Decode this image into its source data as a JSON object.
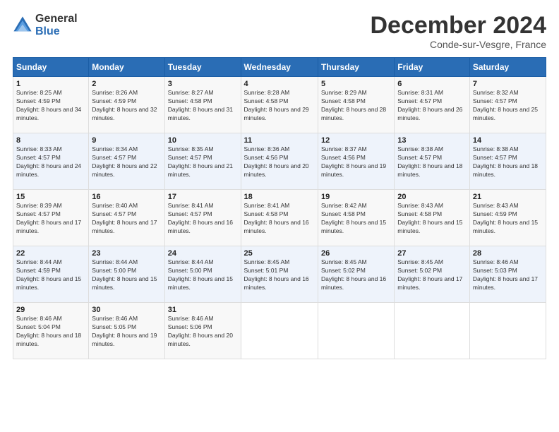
{
  "logo": {
    "general": "General",
    "blue": "Blue"
  },
  "title": "December 2024",
  "location": "Conde-sur-Vesgre, France",
  "headers": [
    "Sunday",
    "Monday",
    "Tuesday",
    "Wednesday",
    "Thursday",
    "Friday",
    "Saturday"
  ],
  "weeks": [
    [
      {
        "num": "1",
        "rise": "8:25 AM",
        "set": "4:59 PM",
        "daylight": "8 hours and 34 minutes."
      },
      {
        "num": "2",
        "rise": "8:26 AM",
        "set": "4:59 PM",
        "daylight": "8 hours and 32 minutes."
      },
      {
        "num": "3",
        "rise": "8:27 AM",
        "set": "4:58 PM",
        "daylight": "8 hours and 31 minutes."
      },
      {
        "num": "4",
        "rise": "8:28 AM",
        "set": "4:58 PM",
        "daylight": "8 hours and 29 minutes."
      },
      {
        "num": "5",
        "rise": "8:29 AM",
        "set": "4:58 PM",
        "daylight": "8 hours and 28 minutes."
      },
      {
        "num": "6",
        "rise": "8:31 AM",
        "set": "4:57 PM",
        "daylight": "8 hours and 26 minutes."
      },
      {
        "num": "7",
        "rise": "8:32 AM",
        "set": "4:57 PM",
        "daylight": "8 hours and 25 minutes."
      }
    ],
    [
      {
        "num": "8",
        "rise": "8:33 AM",
        "set": "4:57 PM",
        "daylight": "8 hours and 24 minutes."
      },
      {
        "num": "9",
        "rise": "8:34 AM",
        "set": "4:57 PM",
        "daylight": "8 hours and 22 minutes."
      },
      {
        "num": "10",
        "rise": "8:35 AM",
        "set": "4:57 PM",
        "daylight": "8 hours and 21 minutes."
      },
      {
        "num": "11",
        "rise": "8:36 AM",
        "set": "4:56 PM",
        "daylight": "8 hours and 20 minutes."
      },
      {
        "num": "12",
        "rise": "8:37 AM",
        "set": "4:56 PM",
        "daylight": "8 hours and 19 minutes."
      },
      {
        "num": "13",
        "rise": "8:38 AM",
        "set": "4:57 PM",
        "daylight": "8 hours and 18 minutes."
      },
      {
        "num": "14",
        "rise": "8:38 AM",
        "set": "4:57 PM",
        "daylight": "8 hours and 18 minutes."
      }
    ],
    [
      {
        "num": "15",
        "rise": "8:39 AM",
        "set": "4:57 PM",
        "daylight": "8 hours and 17 minutes."
      },
      {
        "num": "16",
        "rise": "8:40 AM",
        "set": "4:57 PM",
        "daylight": "8 hours and 17 minutes."
      },
      {
        "num": "17",
        "rise": "8:41 AM",
        "set": "4:57 PM",
        "daylight": "8 hours and 16 minutes."
      },
      {
        "num": "18",
        "rise": "8:41 AM",
        "set": "4:58 PM",
        "daylight": "8 hours and 16 minutes."
      },
      {
        "num": "19",
        "rise": "8:42 AM",
        "set": "4:58 PM",
        "daylight": "8 hours and 15 minutes."
      },
      {
        "num": "20",
        "rise": "8:43 AM",
        "set": "4:58 PM",
        "daylight": "8 hours and 15 minutes."
      },
      {
        "num": "21",
        "rise": "8:43 AM",
        "set": "4:59 PM",
        "daylight": "8 hours and 15 minutes."
      }
    ],
    [
      {
        "num": "22",
        "rise": "8:44 AM",
        "set": "4:59 PM",
        "daylight": "8 hours and 15 minutes."
      },
      {
        "num": "23",
        "rise": "8:44 AM",
        "set": "5:00 PM",
        "daylight": "8 hours and 15 minutes."
      },
      {
        "num": "24",
        "rise": "8:44 AM",
        "set": "5:00 PM",
        "daylight": "8 hours and 15 minutes."
      },
      {
        "num": "25",
        "rise": "8:45 AM",
        "set": "5:01 PM",
        "daylight": "8 hours and 16 minutes."
      },
      {
        "num": "26",
        "rise": "8:45 AM",
        "set": "5:02 PM",
        "daylight": "8 hours and 16 minutes."
      },
      {
        "num": "27",
        "rise": "8:45 AM",
        "set": "5:02 PM",
        "daylight": "8 hours and 17 minutes."
      },
      {
        "num": "28",
        "rise": "8:46 AM",
        "set": "5:03 PM",
        "daylight": "8 hours and 17 minutes."
      }
    ],
    [
      {
        "num": "29",
        "rise": "8:46 AM",
        "set": "5:04 PM",
        "daylight": "8 hours and 18 minutes."
      },
      {
        "num": "30",
        "rise": "8:46 AM",
        "set": "5:05 PM",
        "daylight": "8 hours and 19 minutes."
      },
      {
        "num": "31",
        "rise": "8:46 AM",
        "set": "5:06 PM",
        "daylight": "8 hours and 20 minutes."
      },
      null,
      null,
      null,
      null
    ]
  ]
}
